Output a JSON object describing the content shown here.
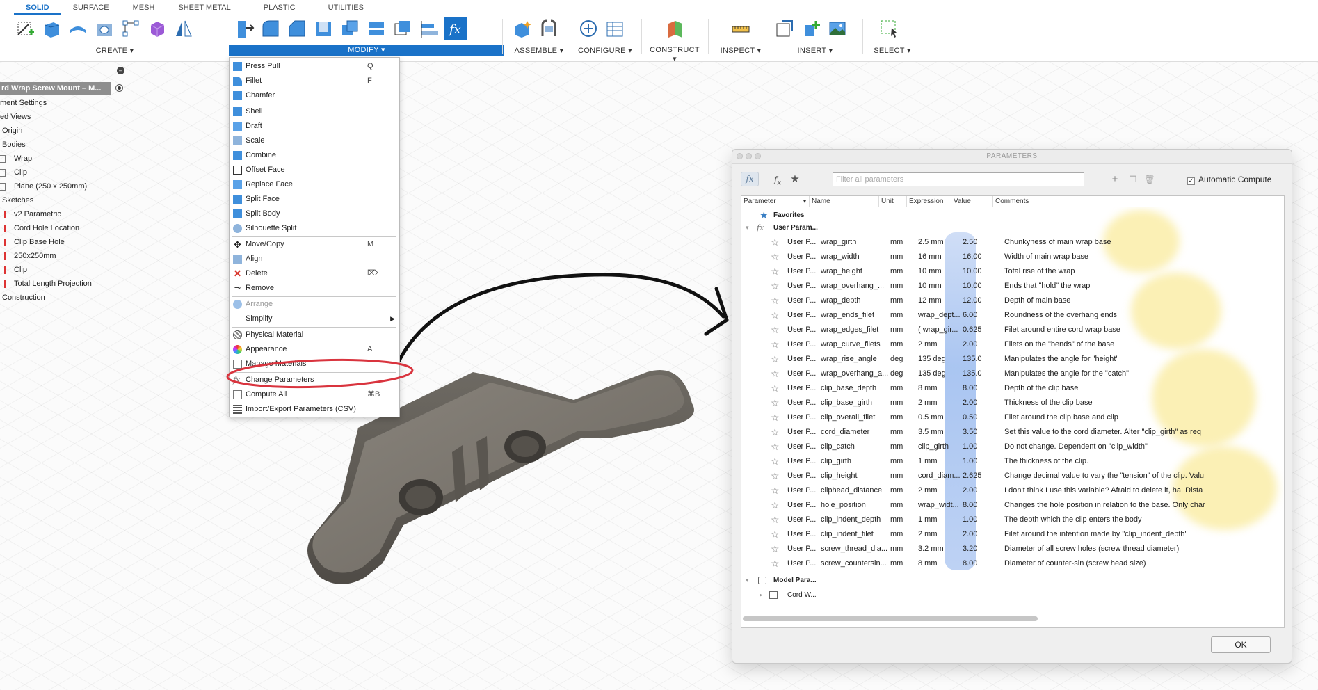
{
  "tabs": [
    "SOLID",
    "SURFACE",
    "MESH",
    "SHEET METAL",
    "PLASTIC",
    "UTILITIES"
  ],
  "toolbar_groups": {
    "create": "CREATE ▾",
    "modify": "MODIFY ▾",
    "assemble": "ASSEMBLE ▾",
    "configure": "CONFIGURE ▾",
    "construct": "CONSTRUCT ▾",
    "inspect": "INSPECT ▾",
    "insert": "INSERT ▾",
    "select": "SELECT ▾"
  },
  "browser": {
    "collapse": "–",
    "doc_title": "rd Wrap Screw Mount – M...",
    "items": [
      "ment Settings",
      "ed Views",
      "Origin",
      "Bodies",
      "Wrap",
      "Clip",
      "Plane (250 x 250mm)",
      "Sketches",
      "v2 Parametric",
      "Cord Hole Location",
      "Clip Base Hole",
      "250x250mm",
      "Clip",
      "Total Length Projection",
      "Construction"
    ]
  },
  "modify_menu": [
    {
      "label": "Press Pull",
      "shortcut": "Q"
    },
    {
      "label": "Fillet",
      "shortcut": "F"
    },
    {
      "label": "Chamfer",
      "shortcut": ""
    },
    {
      "label": "Shell",
      "shortcut": ""
    },
    {
      "label": "Draft",
      "shortcut": ""
    },
    {
      "label": "Scale",
      "shortcut": ""
    },
    {
      "label": "Combine",
      "shortcut": ""
    },
    {
      "label": "Offset Face",
      "shortcut": ""
    },
    {
      "label": "Replace Face",
      "shortcut": ""
    },
    {
      "label": "Split Face",
      "shortcut": ""
    },
    {
      "label": "Split Body",
      "shortcut": ""
    },
    {
      "label": "Silhouette Split",
      "shortcut": ""
    },
    {
      "label": "Move/Copy",
      "shortcut": "M"
    },
    {
      "label": "Align",
      "shortcut": ""
    },
    {
      "label": "Delete",
      "shortcut": "⌦"
    },
    {
      "label": "Remove",
      "shortcut": ""
    },
    {
      "label": "Arrange",
      "shortcut": ""
    },
    {
      "label": "Simplify",
      "shortcut": ""
    },
    {
      "label": "Physical Material",
      "shortcut": ""
    },
    {
      "label": "Appearance",
      "shortcut": "A"
    },
    {
      "label": "Manage Materials",
      "shortcut": ""
    },
    {
      "label": "Change Parameters",
      "shortcut": ""
    },
    {
      "label": "Compute All",
      "shortcut": "⌘B"
    },
    {
      "label": "Import/Export Parameters (CSV)",
      "shortcut": ""
    }
  ],
  "dialog": {
    "title": "PARAMETERS",
    "filter_placeholder": "Filter all parameters",
    "auto_compute": "Automatic Compute",
    "auto_check": "✓",
    "ok": "OK",
    "columns": [
      "Parameter",
      "Name",
      "Unit",
      "Expression",
      "Value",
      "Comments"
    ],
    "favorites": "Favorites",
    "user_group": "User Param...",
    "model_group": "Model Para...",
    "model_child": "Cord W...",
    "rows": [
      {
        "param": "User P...",
        "name": "wrap_girth",
        "unit": "mm",
        "expr": "2.5 mm",
        "value": "2.50",
        "comment": "Chunkyness of main wrap base"
      },
      {
        "param": "User P...",
        "name": "wrap_width",
        "unit": "mm",
        "expr": "16 mm",
        "value": "16.00",
        "comment": "Width of main wrap base"
      },
      {
        "param": "User P...",
        "name": "wrap_height",
        "unit": "mm",
        "expr": "10 mm",
        "value": "10.00",
        "comment": "Total rise of the wrap"
      },
      {
        "param": "User P...",
        "name": "wrap_overhang_...",
        "unit": "mm",
        "expr": "10 mm",
        "value": "10.00",
        "comment": "Ends that \"hold\" the wrap"
      },
      {
        "param": "User P...",
        "name": "wrap_depth",
        "unit": "mm",
        "expr": "12 mm",
        "value": "12.00",
        "comment": "Depth of main base"
      },
      {
        "param": "User P...",
        "name": "wrap_ends_filet",
        "unit": "mm",
        "expr": "wrap_dept...",
        "value": "6.00",
        "comment": "Roundness of the overhang ends"
      },
      {
        "param": "User P...",
        "name": "wrap_edges_filet",
        "unit": "mm",
        "expr": "( wrap_gir...",
        "value": "0.625",
        "comment": "Filet around entire cord wrap base"
      },
      {
        "param": "User P...",
        "name": "wrap_curve_filets",
        "unit": "mm",
        "expr": "2 mm",
        "value": "2.00",
        "comment": "Filets on the \"bends\" of the base"
      },
      {
        "param": "User P...",
        "name": "wrap_rise_angle",
        "unit": "deg",
        "expr": "135 deg",
        "value": "135.0",
        "comment": "Manipulates the angle for \"height\""
      },
      {
        "param": "User P...",
        "name": "wrap_overhang_a...",
        "unit": "deg",
        "expr": "135 deg",
        "value": "135.0",
        "comment": "Manipulates the angle for the \"catch\""
      },
      {
        "param": "User P...",
        "name": "clip_base_depth",
        "unit": "mm",
        "expr": "8 mm",
        "value": "8.00",
        "comment": "Depth of the clip base"
      },
      {
        "param": "User P...",
        "name": "clip_base_girth",
        "unit": "mm",
        "expr": "2 mm",
        "value": "2.00",
        "comment": "Thickness of the clip base"
      },
      {
        "param": "User P...",
        "name": "clip_overall_filet",
        "unit": "mm",
        "expr": "0.5 mm",
        "value": "0.50",
        "comment": "Filet around the clip base and clip"
      },
      {
        "param": "User P...",
        "name": "cord_diameter",
        "unit": "mm",
        "expr": "3.5 mm",
        "value": "3.50",
        "comment": "Set this value to the cord diameter. Alter \"clip_girth\" as req"
      },
      {
        "param": "User P...",
        "name": "clip_catch",
        "unit": "mm",
        "expr": "clip_girth",
        "value": "1.00",
        "comment": "Do not change. Dependent on \"clip_width\""
      },
      {
        "param": "User P...",
        "name": "clip_girth",
        "unit": "mm",
        "expr": "1 mm",
        "value": "1.00",
        "comment": "The thickness of the clip."
      },
      {
        "param": "User P...",
        "name": "clip_height",
        "unit": "mm",
        "expr": "cord_diam...",
        "value": "2.625",
        "comment": "Change decimal value to vary the \"tension\" of the clip. Valu"
      },
      {
        "param": "User P...",
        "name": "cliphead_distance",
        "unit": "mm",
        "expr": "2 mm",
        "value": "2.00",
        "comment": "I don't think I use this variable? Afraid to delete it, ha. Dista"
      },
      {
        "param": "User P...",
        "name": "hole_position",
        "unit": "mm",
        "expr": "wrap_widt...",
        "value": "8.00",
        "comment": "Changes the hole position in relation to the base. Only char"
      },
      {
        "param": "User P...",
        "name": "clip_indent_depth",
        "unit": "mm",
        "expr": "1 mm",
        "value": "1.00",
        "comment": "The depth which the clip enters the body"
      },
      {
        "param": "User P...",
        "name": "clip_indent_filet",
        "unit": "mm",
        "expr": "2 mm",
        "value": "2.00",
        "comment": "Filet around the intention made by \"clip_indent_depth\""
      },
      {
        "param": "User P...",
        "name": "screw_thread_dia...",
        "unit": "mm",
        "expr": "3.2 mm",
        "value": "3.20",
        "comment": "Diameter of all screw holes (screw thread diameter)"
      },
      {
        "param": "User P...",
        "name": "screw_countersin...",
        "unit": "mm",
        "expr": "8 mm",
        "value": "8.00",
        "comment": "Diameter of counter-sin (screw head size)"
      }
    ]
  }
}
